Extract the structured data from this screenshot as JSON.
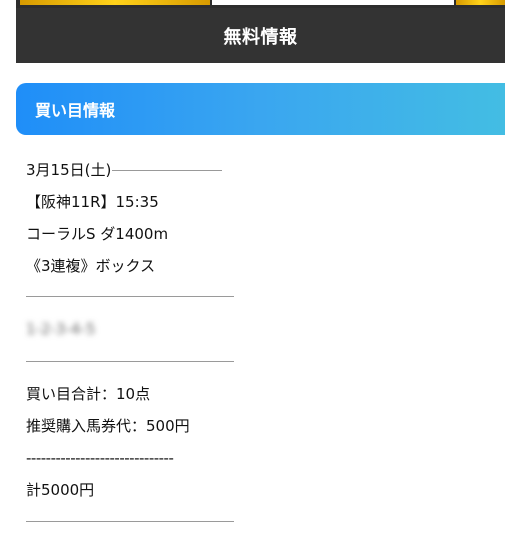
{
  "header": {
    "title": "無料情報"
  },
  "section": {
    "title": "買い目情報"
  },
  "race": {
    "date": "3月15日(土)",
    "venue_race_time": "【阪神11R】15:35",
    "race_name": "コーラルS ダ1400m",
    "bet_type": "《3連複》ボックス"
  },
  "picks": {
    "blurred_text": "1-2-3-4-5"
  },
  "summary": {
    "total_bets": "買い目合計：10点",
    "recommended": "推奨購入馬券代：500円",
    "dashes": "------------------------------",
    "total_amount": "計5000円"
  },
  "colors": {
    "header_bg": "#333333",
    "section_gradient_start": "#1f8ef8",
    "section_gradient_end": "#43bde3",
    "banner_gold": "#ffd21a"
  }
}
